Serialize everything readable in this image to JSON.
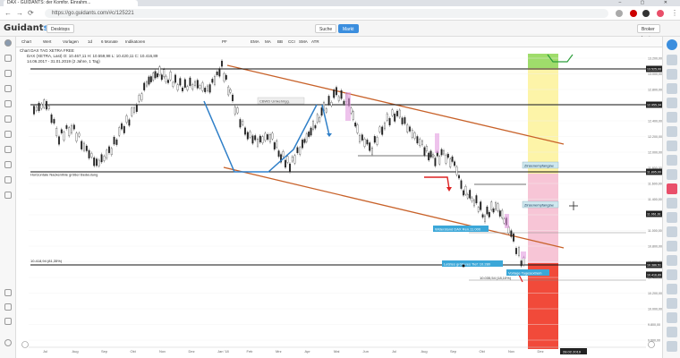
{
  "browser": {
    "tab_title": "DAX - GUIDANTS: der Komfor. Einrahm...",
    "window_controls": "– ▢ ✕",
    "url": "https://go.guidants.com/#c/125221"
  },
  "header": {
    "logo_main": "Guidant",
    "logo_accent": "s",
    "desktop_label": "Desktops",
    "search_label": "Suche",
    "market_label": "Markt",
    "broker_label": "Broker Login"
  },
  "toolbar": {
    "items": [
      "Chart",
      "Wert",
      "Vorlagen",
      "1d",
      "6 Monate",
      "Indikatoren",
      "PF",
      "EMA",
      "MA",
      "BB",
      "CCI",
      "SMA",
      "ATR"
    ]
  },
  "chart": {
    "window_title": "Chart DAX TAG XETRA FREE",
    "instrument_line": "DAX (XETRA, Last) O: 10.467,11 H: 10.559,98 L: 10.420,11 C: 10.416,89",
    "period_line": "14.06.2017 - 31.01.2019 (2 Jahre, 1 Tag)",
    "x_labels": [
      "Jul",
      "Aug",
      "Sep",
      "Okt",
      "Nov",
      "Dez",
      "Jan '18",
      "Feb",
      "Mrz",
      "Apr",
      "Mai",
      "Jun",
      "Jul",
      "Aug",
      "Sep",
      "Okt",
      "Nov",
      "Dez",
      "Jan"
    ],
    "price_labels": [
      "13.200,00",
      "13.000,00",
      "12.800,00",
      "12.600,00",
      "12.400,00",
      "12.200,00",
      "12.000,00",
      "11.800,00",
      "11.600,00",
      "11.400,00",
      "11.200,00",
      "11.000,00",
      "10.800,00",
      "10.600,00",
      "10.400,00",
      "10.200,00",
      "10.000,00",
      "9.800,00",
      "9.600,00"
    ],
    "level_tags": [
      "13.525,00",
      "12.955,34",
      "11.895,00",
      "11.061,61",
      "10.386,51",
      "10.416,89"
    ],
    "annotations": {
      "aufwaerts": "CBWD Umkehrlgg.",
      "zone_upper": "Zinsenempfangsw.",
      "zone_lower": "Zinsenempfangsw.",
      "support_label": "Horizontale Nackenlinie größer Bedeutung",
      "left_level": "10.418,94 (81,35%)",
      "widerstand": "Widerstand DAX Ren.11.000",
      "letztes_tief": "Letztes größeres Tief: 10.280",
      "ziel_label": "Vorlage Tagesextrem",
      "low_label": "10.035,54 (18,10%)",
      "date_tag": "28.02.2019"
    }
  }
}
